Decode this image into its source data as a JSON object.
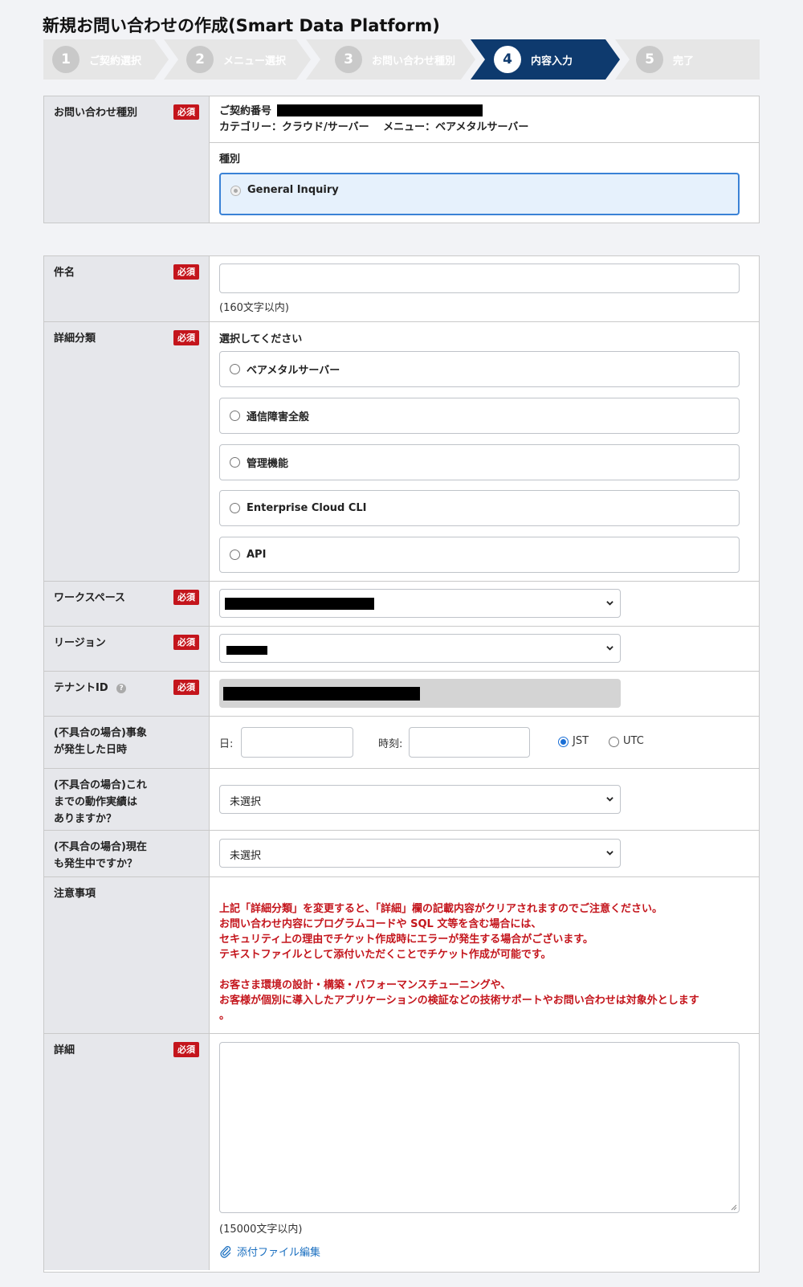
{
  "page": {
    "title": "新規お問い合わせの作成(Smart Data Platform)"
  },
  "steps": [
    {
      "num": "1",
      "label": "ご契約選択"
    },
    {
      "num": "2",
      "label": "メニュー選択"
    },
    {
      "num": "3",
      "label": "お問い合わせ種別"
    },
    {
      "num": "4",
      "label": "内容入力"
    },
    {
      "num": "5",
      "label": "完了"
    }
  ],
  "required_badge": "必須",
  "inquiry_type": {
    "label": "お問い合わせ種別",
    "contract_prefix": "ご契約番号",
    "category_line": "カテゴリー：クラウド/サーバー　 メニュー：ベアメタルサーバー",
    "type_heading": "種別",
    "type_option": "General Inquiry"
  },
  "form": {
    "subject": {
      "label": "件名",
      "hint": "(160文字以内)"
    },
    "detail_category": {
      "label": "詳細分類",
      "prompt": "選択してください",
      "options": [
        "ベアメタルサーバー",
        "通信障害全般",
        "管理機能",
        "Enterprise Cloud CLI",
        "API"
      ]
    },
    "workspace": {
      "label": "ワークスペース"
    },
    "region": {
      "label": "リージョン"
    },
    "tenant_id": {
      "label": "テナントID"
    },
    "occurrence": {
      "label_line1": "(不具合の場合)事象",
      "label_line2": "が発生した日時",
      "day_label": "日:",
      "time_label": "時刻:",
      "tz_jst": "JST",
      "tz_utc": "UTC",
      "tz_selected": "JST"
    },
    "past_operation": {
      "label_line1": "(不具合の場合)これ",
      "label_line2": "までの動作実績は",
      "label_line3": "ありますか？",
      "value": "未選択"
    },
    "still_occurring": {
      "label_line1": "(不具合の場合)現在",
      "label_line2": "も発生中ですか？",
      "value": "未選択"
    },
    "notes": {
      "label": "注意事項",
      "lines": [
        "上記「詳細分類」を変更すると、「詳細」欄の記載内容がクリアされますのでご注意ください。",
        "お問い合わせ内容にプログラムコードや SQL 文等を含む場合には、",
        "セキュリティ上の理由でチケット作成時にエラーが発生する場合がございます。",
        "テキストファイルとして添付いただくことでチケット作成が可能です。",
        "",
        "お客さま環境の設計・構築・パフォーマンスチューニングや、",
        "お客様が個別に導入したアプリケーションの検証などの技術サポートやお問い合わせは対象外とします",
        "。"
      ]
    },
    "details": {
      "label": "詳細",
      "hint": "(15000文字以内)",
      "attach_link": "添付ファイル編集"
    }
  },
  "colors": {
    "active_step": "#0e3a6e",
    "inactive_step": "#e6e6e6",
    "required_badge": "#c4151c",
    "notice_text": "#c4151c",
    "link": "#1a6fc0",
    "selected_option_bg": "#e6f1fc",
    "selected_option_border": "#3a82d6"
  }
}
